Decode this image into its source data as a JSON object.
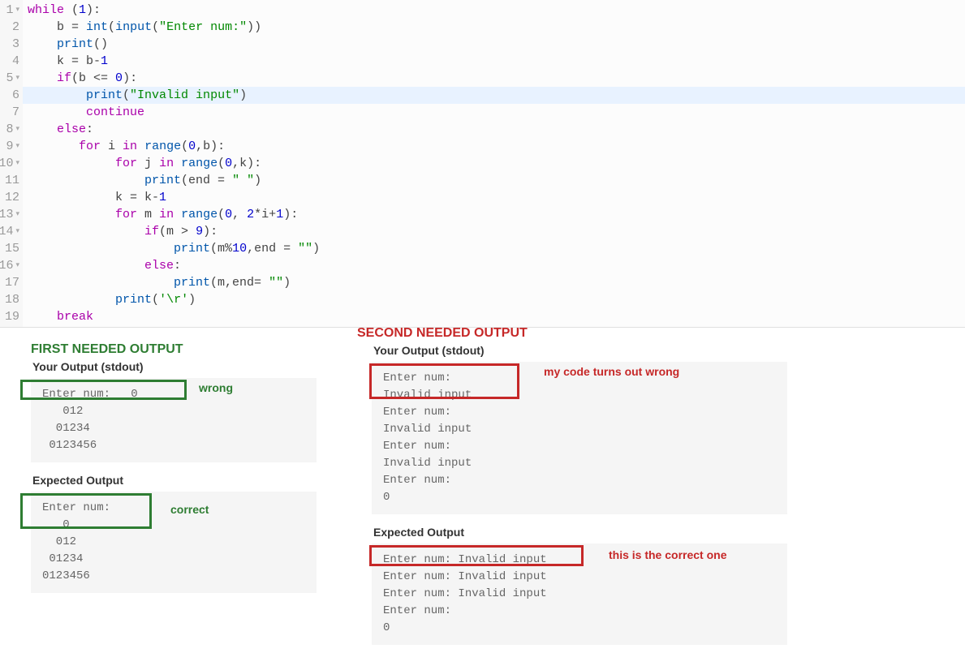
{
  "line_numbers": [
    "1",
    "2",
    "3",
    "4",
    "5",
    "6",
    "7",
    "8",
    "9",
    "10",
    "11",
    "12",
    "13",
    "14",
    "15",
    "16",
    "17",
    "18",
    "19"
  ],
  "fold_lines": [
    1,
    5,
    8,
    9,
    10,
    13,
    14,
    16
  ],
  "code_lines": [
    {
      "indent": "",
      "tokens": [
        {
          "t": "while",
          "c": "k"
        },
        {
          "t": " (",
          "c": "c"
        },
        {
          "t": "1",
          "c": "n"
        },
        {
          "t": "):",
          "c": "c"
        }
      ]
    },
    {
      "indent": "    ",
      "tokens": [
        {
          "t": "b = ",
          "c": "c"
        },
        {
          "t": "int",
          "c": "f"
        },
        {
          "t": "(",
          "c": "c"
        },
        {
          "t": "input",
          "c": "f"
        },
        {
          "t": "(",
          "c": "c"
        },
        {
          "t": "\"Enter num:\"",
          "c": "s"
        },
        {
          "t": "))",
          "c": "c"
        }
      ]
    },
    {
      "indent": "    ",
      "tokens": [
        {
          "t": "print",
          "c": "f"
        },
        {
          "t": "()",
          "c": "c"
        }
      ]
    },
    {
      "indent": "    ",
      "tokens": [
        {
          "t": "k = b-",
          "c": "c"
        },
        {
          "t": "1",
          "c": "n"
        }
      ]
    },
    {
      "indent": "    ",
      "tokens": [
        {
          "t": "if",
          "c": "k"
        },
        {
          "t": "(b <= ",
          "c": "c"
        },
        {
          "t": "0",
          "c": "n"
        },
        {
          "t": "):",
          "c": "c"
        }
      ]
    },
    {
      "indent": "        ",
      "hl": true,
      "tokens": [
        {
          "t": "print",
          "c": "f"
        },
        {
          "t": "(",
          "c": "c"
        },
        {
          "t": "\"Invalid input\"",
          "c": "s"
        },
        {
          "t": ")",
          "c": "c"
        }
      ]
    },
    {
      "indent": "        ",
      "tokens": [
        {
          "t": "continue",
          "c": "k"
        }
      ]
    },
    {
      "indent": "    ",
      "tokens": [
        {
          "t": "else",
          "c": "k"
        },
        {
          "t": ":",
          "c": "c"
        }
      ]
    },
    {
      "indent": "       ",
      "tokens": [
        {
          "t": "for",
          "c": "k"
        },
        {
          "t": " i ",
          "c": "c"
        },
        {
          "t": "in",
          "c": "k"
        },
        {
          "t": " ",
          "c": "c"
        },
        {
          "t": "range",
          "c": "f"
        },
        {
          "t": "(",
          "c": "c"
        },
        {
          "t": "0",
          "c": "n"
        },
        {
          "t": ",b):",
          "c": "c"
        }
      ]
    },
    {
      "indent": "            ",
      "tokens": [
        {
          "t": "for",
          "c": "k"
        },
        {
          "t": " j ",
          "c": "c"
        },
        {
          "t": "in",
          "c": "k"
        },
        {
          "t": " ",
          "c": "c"
        },
        {
          "t": "range",
          "c": "f"
        },
        {
          "t": "(",
          "c": "c"
        },
        {
          "t": "0",
          "c": "n"
        },
        {
          "t": ",k):",
          "c": "c"
        }
      ]
    },
    {
      "indent": "                ",
      "tokens": [
        {
          "t": "print",
          "c": "f"
        },
        {
          "t": "(end = ",
          "c": "c"
        },
        {
          "t": "\" \"",
          "c": "s"
        },
        {
          "t": ")",
          "c": "c"
        }
      ]
    },
    {
      "indent": "            ",
      "tokens": [
        {
          "t": "k = k-",
          "c": "c"
        },
        {
          "t": "1",
          "c": "n"
        }
      ]
    },
    {
      "indent": "            ",
      "tokens": [
        {
          "t": "for",
          "c": "k"
        },
        {
          "t": " m ",
          "c": "c"
        },
        {
          "t": "in",
          "c": "k"
        },
        {
          "t": " ",
          "c": "c"
        },
        {
          "t": "range",
          "c": "f"
        },
        {
          "t": "(",
          "c": "c"
        },
        {
          "t": "0",
          "c": "n"
        },
        {
          "t": ", ",
          "c": "c"
        },
        {
          "t": "2",
          "c": "n"
        },
        {
          "t": "*i+",
          "c": "c"
        },
        {
          "t": "1",
          "c": "n"
        },
        {
          "t": "):",
          "c": "c"
        }
      ]
    },
    {
      "indent": "                ",
      "tokens": [
        {
          "t": "if",
          "c": "k"
        },
        {
          "t": "(m > ",
          "c": "c"
        },
        {
          "t": "9",
          "c": "n"
        },
        {
          "t": "):",
          "c": "c"
        }
      ]
    },
    {
      "indent": "                    ",
      "tokens": [
        {
          "t": "print",
          "c": "f"
        },
        {
          "t": "(m%",
          "c": "c"
        },
        {
          "t": "10",
          "c": "n"
        },
        {
          "t": ",end = ",
          "c": "c"
        },
        {
          "t": "\"\"",
          "c": "s"
        },
        {
          "t": ")",
          "c": "c"
        }
      ]
    },
    {
      "indent": "                ",
      "tokens": [
        {
          "t": "else",
          "c": "k"
        },
        {
          "t": ":",
          "c": "c"
        }
      ]
    },
    {
      "indent": "                    ",
      "tokens": [
        {
          "t": "print",
          "c": "f"
        },
        {
          "t": "(m,end= ",
          "c": "c"
        },
        {
          "t": "\"\"",
          "c": "s"
        },
        {
          "t": ")",
          "c": "c"
        }
      ]
    },
    {
      "indent": "            ",
      "tokens": [
        {
          "t": "print",
          "c": "f"
        },
        {
          "t": "(",
          "c": "c"
        },
        {
          "t": "'\\r'",
          "c": "s"
        },
        {
          "t": ")",
          "c": "c"
        }
      ]
    },
    {
      "indent": "    ",
      "tokens": [
        {
          "t": "break",
          "c": "k"
        }
      ]
    }
  ],
  "first": {
    "title": "FIRST NEEDED OUTPUT",
    "your_label": "Your Output (stdout)",
    "your_out": "Enter num:   0\n   012\n  01234\n 0123456",
    "wrong_label": "wrong",
    "expected_label": "Expected Output",
    "expected_out": "Enter num: \n   0\n  012\n 01234\n0123456",
    "correct_label": "correct"
  },
  "second": {
    "title": "SECOND NEEDED OUTPUT",
    "your_label": "Your Output (stdout)",
    "your_out": "Enter num: \nInvalid input\nEnter num: \nInvalid input\nEnter num: \nInvalid input\nEnter num: \n0",
    "wrong_label": "my code turns out wrong",
    "expected_label": "Expected Output",
    "expected_out": "Enter num: Invalid input\nEnter num: Invalid input\nEnter num: Invalid input\nEnter num: \n0",
    "correct_label": "this is the correct one"
  }
}
